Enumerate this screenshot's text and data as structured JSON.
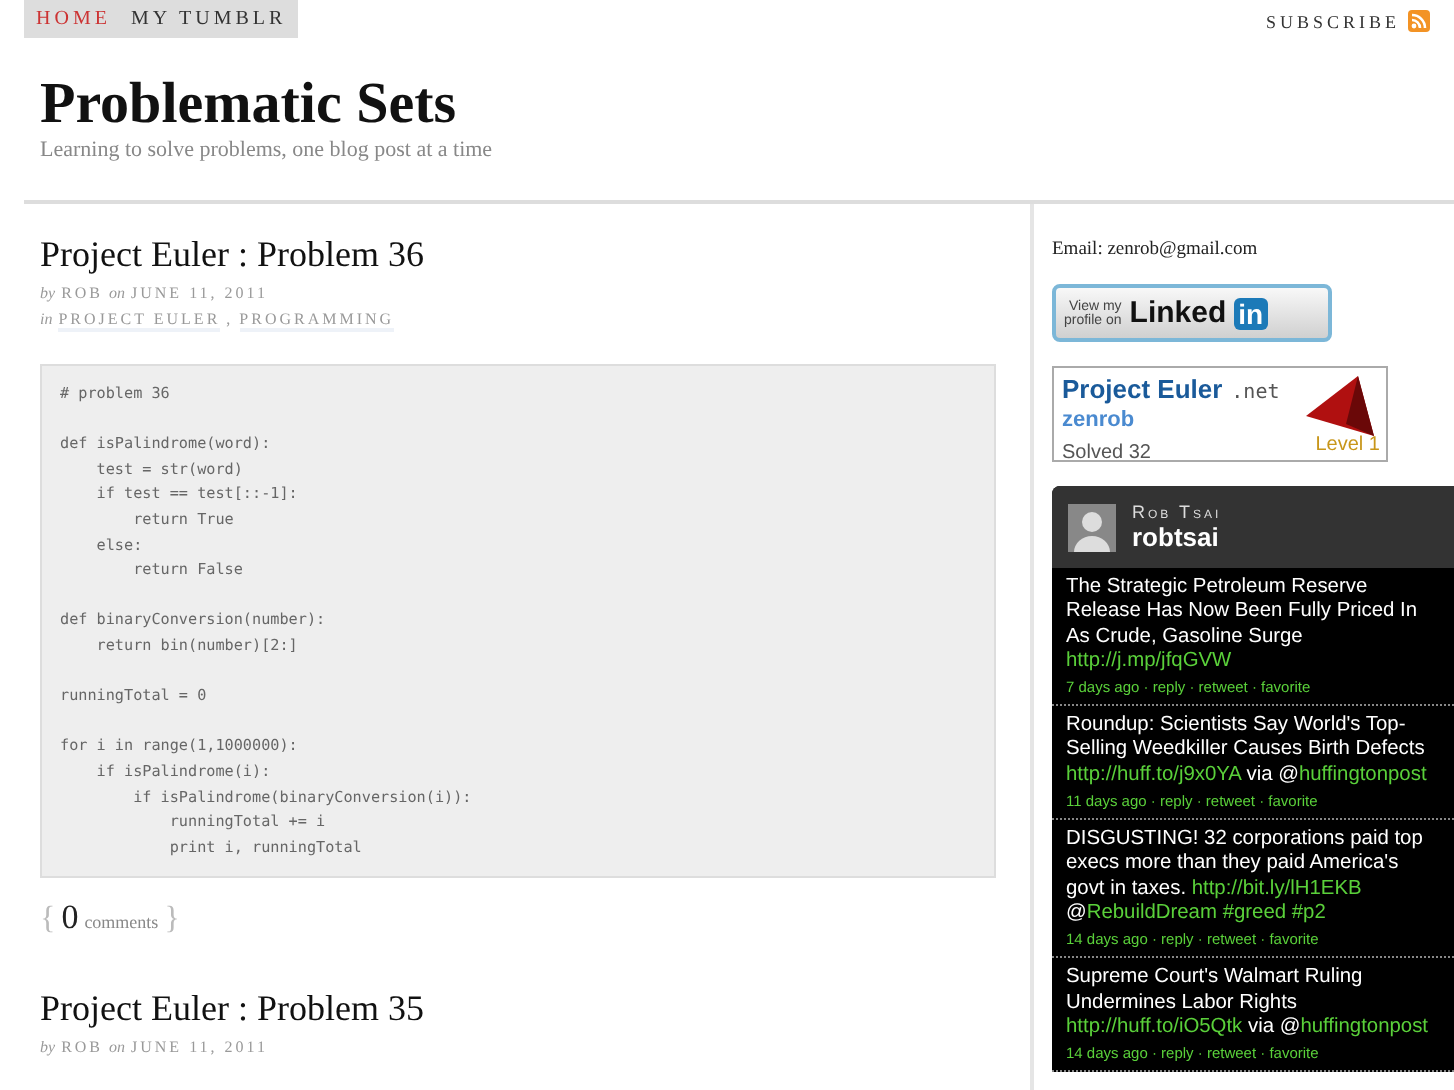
{
  "nav": {
    "items": [
      {
        "label": "HOME",
        "selected": true
      },
      {
        "label": "MY TUMBLR",
        "selected": false
      }
    ],
    "subscribe": "SUBSCRIBE"
  },
  "header": {
    "title": "Problematic Sets",
    "tagline": "Learning to solve problems, one blog post at a time"
  },
  "posts": [
    {
      "title": "Project Euler : Problem 36",
      "by": "by",
      "author": "ROB",
      "on": "on",
      "date": "JUNE 11, 2011",
      "in": "in",
      "categories": [
        "PROJECT EULER",
        "PROGRAMMING"
      ],
      "category_separator": ",",
      "code": "# problem 36\n\ndef isPalindrome(word):\n    test = str(word)\n    if test == test[::-1]:\n        return True\n    else:\n        return False\n\ndef binaryConversion(number):\n    return bin(number)[2:]\n\nrunningTotal = 0\n\nfor i in range(1,1000000):\n    if isPalindrome(i):\n        if isPalindrome(binaryConversion(i)):\n            runningTotal += i\n            print i, runningTotal",
      "comments_open": "{",
      "comments_count": "0",
      "comments_label": "comments",
      "comments_close": "}"
    },
    {
      "title": "Project Euler : Problem 35",
      "by": "by",
      "author": "ROB",
      "on": "on",
      "date": "JUNE 11, 2011"
    }
  ],
  "sidebar": {
    "email": "Email: zenrob@gmail.com",
    "linkedin": {
      "line_1": "View my",
      "line_2": "profile on",
      "brand": "Linked",
      "brand_box": "in"
    },
    "euler": {
      "title": "Project Euler",
      "suffix": ".net",
      "user": "zenrob",
      "solved": "Solved 32",
      "level": "Level 1"
    },
    "twitter": {
      "name": "Rob Tsai",
      "handle": "robtsai",
      "tweets": [
        {
          "parts": [
            {
              "kind": "text",
              "text": "The Strategic Petroleum Reserve Release Has Now Been Fully Priced In As Crude, Gasoline Surge "
            },
            {
              "kind": "link",
              "text": "http://j.mp/jfqGVW"
            }
          ],
          "meta": "7 days ago · reply · retweet · favorite"
        },
        {
          "parts": [
            {
              "kind": "text",
              "text": "Roundup: Scientists Say World's Top-Selling Weedkiller Causes Birth Defects "
            },
            {
              "kind": "link",
              "text": "http://huff.to/j9x0YA"
            },
            {
              "kind": "text",
              "text": " via @"
            },
            {
              "kind": "link",
              "text": "huffingtonpost"
            }
          ],
          "meta": "11 days ago · reply · retweet · favorite"
        },
        {
          "parts": [
            {
              "kind": "text",
              "text": "DISGUSTING! 32 corporations paid top execs more than they paid America's govt in taxes. "
            },
            {
              "kind": "link",
              "text": "http://bit.ly/lH1EKB"
            },
            {
              "kind": "text",
              "text": " @"
            },
            {
              "kind": "link",
              "text": "RebuildDream"
            },
            {
              "kind": "spaced_link",
              "text": "#greed"
            },
            {
              "kind": "spaced_link",
              "text": "#p2"
            }
          ],
          "meta": "14 days ago · reply · retweet · favorite"
        },
        {
          "parts": [
            {
              "kind": "text",
              "text": "Supreme Court's Walmart Ruling Undermines Labor Rights "
            },
            {
              "kind": "link",
              "text": "http://huff.to/iO5Qtk"
            },
            {
              "kind": "text",
              "text": " via @"
            },
            {
              "kind": "link",
              "text": "huffingtonpost"
            }
          ],
          "meta": "14 days ago · reply · retweet · favorite"
        }
      ]
    }
  }
}
